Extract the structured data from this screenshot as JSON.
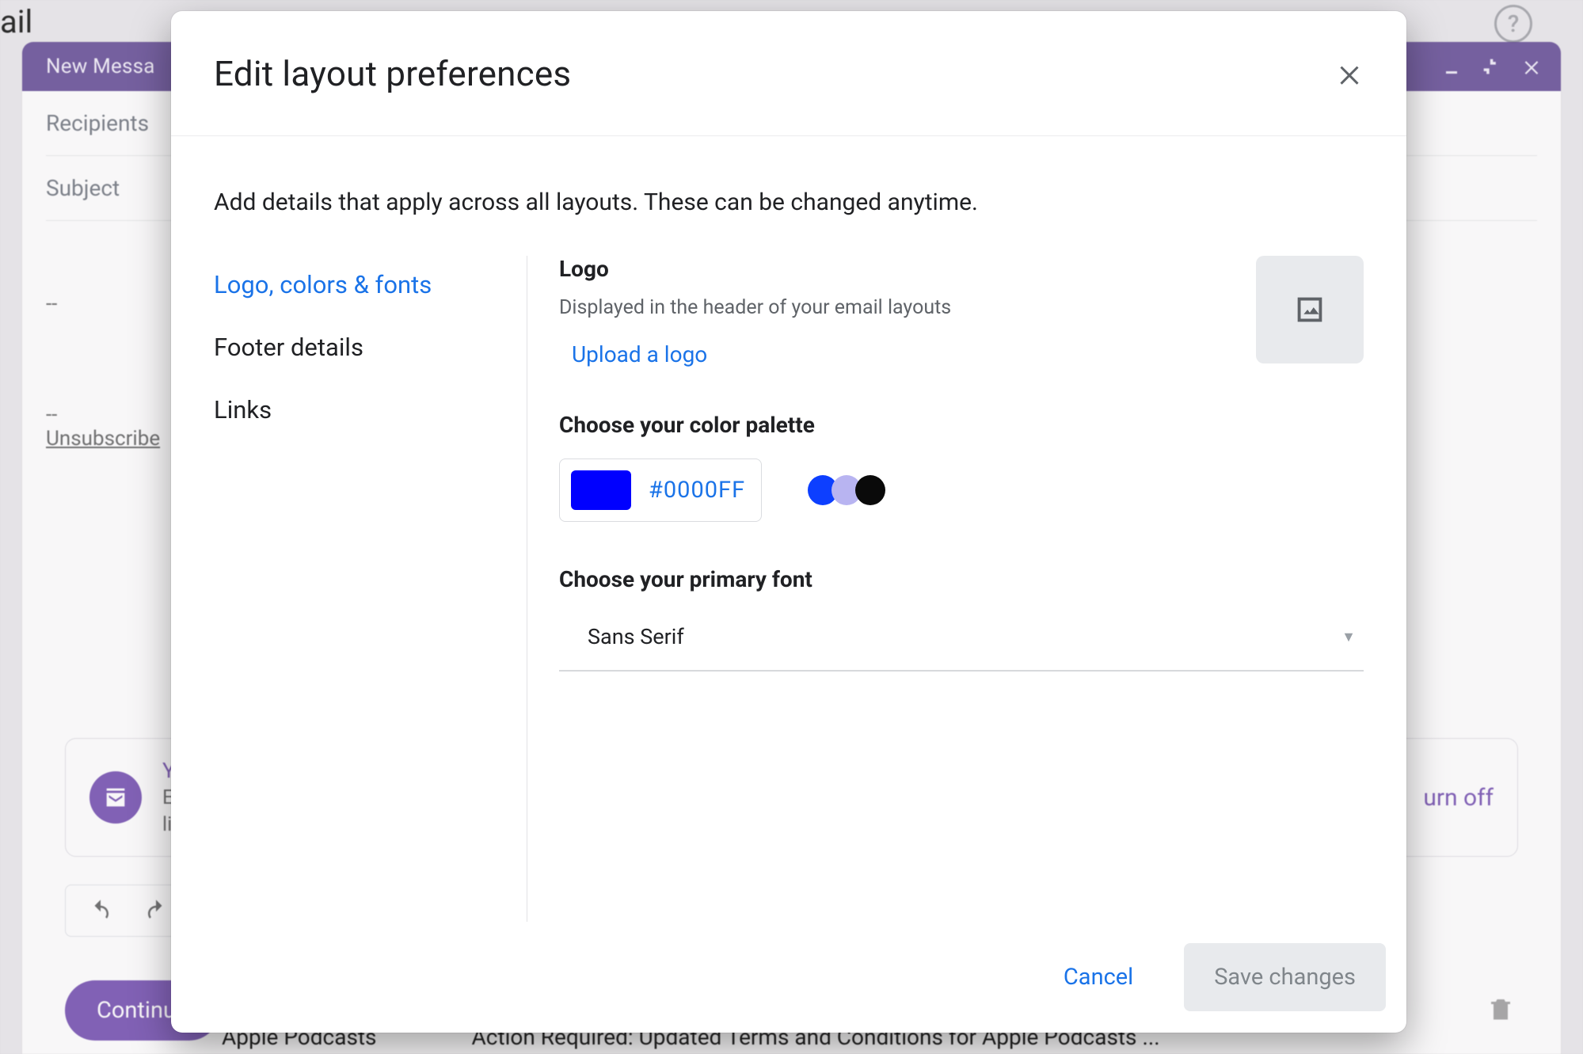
{
  "background": {
    "mail_label": "ail",
    "compose_title": "New Messa",
    "recipients_label": "Recipients",
    "subject_label": "Subject",
    "sig_dashes": "--",
    "unsubscribe": "Unsubscribe",
    "promo_Yo": "Yo",
    "promo_l1": "Ea",
    "promo_l2": "lis",
    "turn_off": "urn off",
    "continue": "Continue",
    "bottom_sender": "Apple Podcasts",
    "bottom_subject": "Action Required: Updated Terms and Conditions for Apple Podcasts ..."
  },
  "modal": {
    "title": "Edit layout preferences",
    "subhead": "Add details that apply across all layouts. These can be changed anytime.",
    "nav": {
      "active": "Logo, colors & fonts",
      "item2": "Footer details",
      "item3": "Links"
    },
    "logo": {
      "title": "Logo",
      "sub": "Displayed in the header of your email layouts",
      "upload": "Upload a logo"
    },
    "palette": {
      "title": "Choose your color palette",
      "hex": "#0000FF",
      "dots": [
        "#0d3fff",
        "#b8b4f1",
        "#0a0a0a"
      ]
    },
    "font": {
      "title": "Choose your primary font",
      "value": "Sans Serif"
    },
    "footer": {
      "cancel": "Cancel",
      "save": "Save changes"
    }
  }
}
